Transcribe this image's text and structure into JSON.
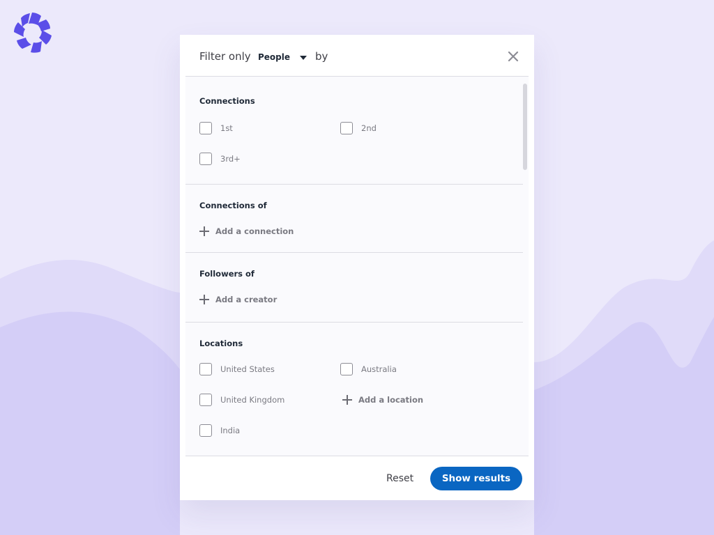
{
  "header": {
    "filter_label": "Filter only",
    "type_value": "People",
    "by_label": "by"
  },
  "sections": {
    "connections": {
      "title": "Connections",
      "options": [
        "1st",
        "2nd",
        "3rd+"
      ]
    },
    "connections_of": {
      "title": "Connections of",
      "add_label": "Add a connection"
    },
    "followers_of": {
      "title": "Followers of",
      "add_label": "Add a creator"
    },
    "locations": {
      "title": "Locations",
      "options": [
        "United States",
        "Australia",
        "United Kingdom",
        "India"
      ],
      "add_label": "Add a location"
    }
  },
  "footer": {
    "reset_label": "Reset",
    "show_results_label": "Show results"
  },
  "colors": {
    "primary": "#0A66C2",
    "background": "#ECE9FB",
    "brand": "#5B4EE8"
  },
  "icons": {
    "logo": "brand-logo-icon",
    "close": "close-icon",
    "caret": "caret-down-icon",
    "add": "plus-icon"
  }
}
